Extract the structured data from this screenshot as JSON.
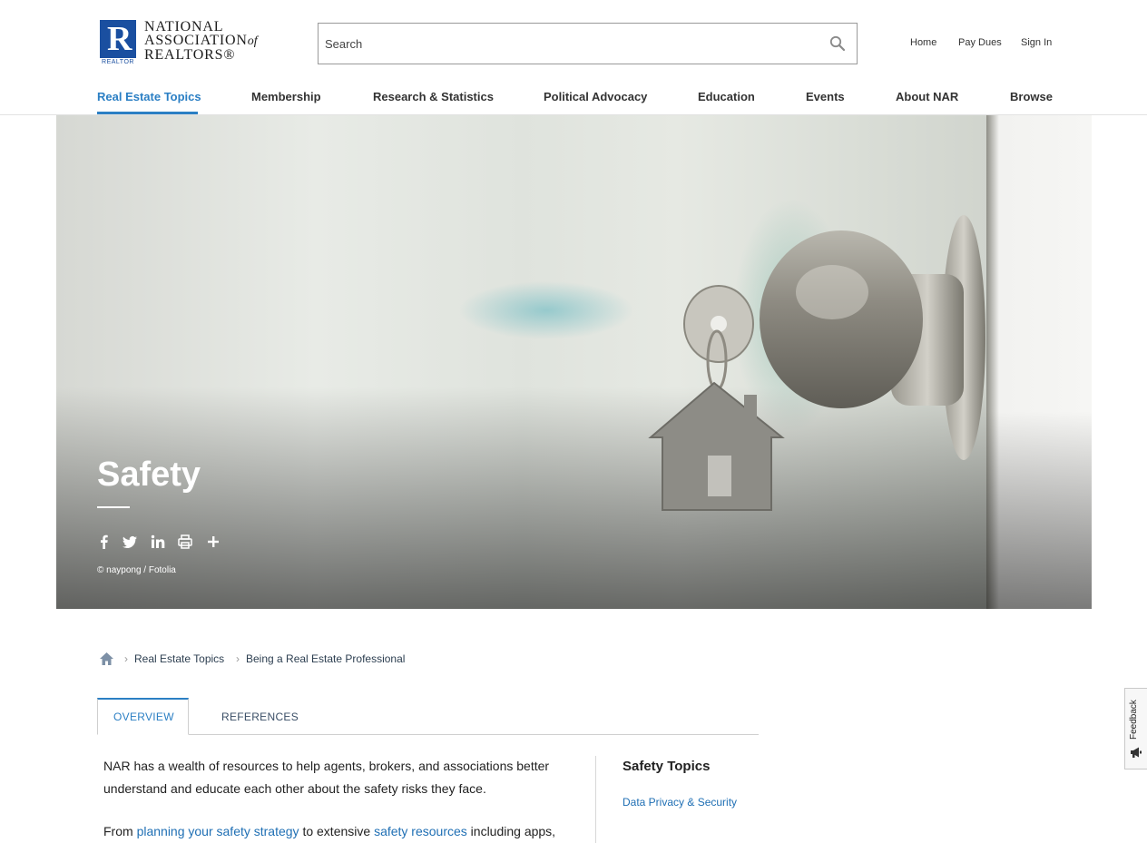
{
  "brand": {
    "logo_letter": "R",
    "logo_sub": "REALTOR",
    "line1": "NATIONAL",
    "line2": "ASSOCIATION",
    "line2_of": "of",
    "line3": "REALTORS®",
    "color": "#1a4fa0"
  },
  "search": {
    "placeholder": "Search",
    "icon": "search-icon"
  },
  "utility_nav": {
    "home": "Home",
    "pay_dues": "Pay Dues",
    "sign_in": "Sign In"
  },
  "main_nav": {
    "items": [
      {
        "label": "Real Estate Topics",
        "active": true
      },
      {
        "label": "Membership"
      },
      {
        "label": "Research & Statistics"
      },
      {
        "label": "Political Advocacy"
      },
      {
        "label": "Education"
      },
      {
        "label": "Events"
      },
      {
        "label": "About NAR"
      },
      {
        "label": "Browse"
      }
    ],
    "accent": "#2b7fc4"
  },
  "hero": {
    "title": "Safety",
    "credit": "© naypong / Fotolia",
    "share_icons": [
      "facebook-icon",
      "twitter-icon",
      "linkedin-icon",
      "print-icon",
      "plus-icon"
    ]
  },
  "breadcrumb": {
    "home_icon": "home-icon",
    "items": [
      "Real Estate Topics",
      "Being a Real Estate Professional"
    ]
  },
  "tabs": [
    {
      "label": "OVERVIEW",
      "active": true
    },
    {
      "label": "REFERENCES"
    }
  ],
  "content": {
    "intro": "NAR has a wealth of resources to help agents, brokers, and associations better understand and educate each other about the safety risks they face.",
    "p2_start": "From ",
    "p2_link1": "planning your safety strategy",
    "p2_mid": " to extensive ",
    "p2_link2": "safety resources",
    "p2_end": " including apps,"
  },
  "sidebar": {
    "title": "Safety Topics",
    "links": [
      "Data Privacy & Security"
    ]
  },
  "feedback": {
    "label": "Feedback",
    "icon": "megaphone-icon"
  },
  "colors": {
    "link": "#1f6fb4",
    "accent": "#2b7fc4",
    "text": "#222222"
  }
}
